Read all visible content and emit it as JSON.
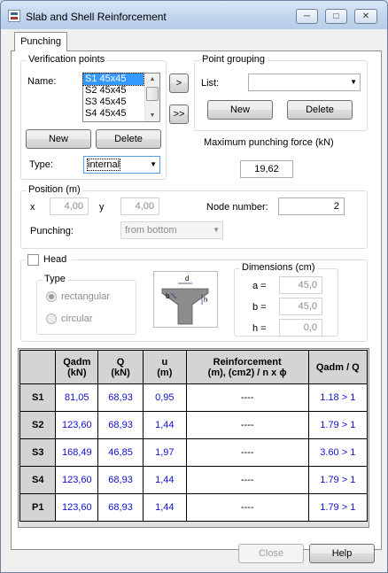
{
  "window": {
    "title": "Slab and Shell Reinforcement",
    "minimize": "─",
    "maximize": "□",
    "close": "✕"
  },
  "tabs": [
    {
      "label": "Punching"
    }
  ],
  "verification": {
    "legend": "Verification points",
    "name_label": "Name:",
    "items": [
      "S1 45x45",
      "S2 45x45",
      "S3 45x45",
      "S4 45x45"
    ],
    "selected_index": 0,
    "new_label": "New",
    "delete_label": "Delete",
    "type_label": "Type:",
    "type_value": "internal"
  },
  "transfer": {
    "move_one": ">",
    "move_all": ">>"
  },
  "grouping": {
    "legend": "Point grouping",
    "list_label": "List:",
    "list_value": "",
    "new_label": "New",
    "delete_label": "Delete"
  },
  "max_force": {
    "label": "Maximum punching force (kN)",
    "value": "19,62"
  },
  "position": {
    "legend": "Position (m)",
    "x_label": "x",
    "x_value": "4,00",
    "y_label": "y",
    "y_value": "4,00",
    "node_label": "Node number:",
    "node_value": "2",
    "punching_label": "Punching:",
    "punching_value": "from bottom"
  },
  "head": {
    "label": "Head",
    "checked": false,
    "type_legend": "Type",
    "options": [
      "rectangular",
      "circular"
    ],
    "selected": "rectangular",
    "diagram_labels": {
      "b": "b",
      "d": "d",
      "h": "h"
    }
  },
  "dimensions": {
    "legend": "Dimensions (cm)",
    "a_label": "a =",
    "a_value": "45,0",
    "b_label": "b =",
    "b_value": "45,0",
    "h_label": "h =",
    "h_value": "0,0"
  },
  "table": {
    "headers": [
      "",
      "Qadm\n(kN)",
      "Q\n(kN)",
      "u\n(m)",
      "Reinforcement\n(m), (cm2) / n x ϕ",
      "Qadm / Q"
    ],
    "rows": [
      {
        "id": "S1",
        "qadm": "81,05",
        "q": "68,93",
        "u": "0,95",
        "reinf": "----",
        "ratio": "1.18 > 1"
      },
      {
        "id": "S2",
        "qadm": "123,60",
        "q": "68,93",
        "u": "1,44",
        "reinf": "----",
        "ratio": "1.79 > 1"
      },
      {
        "id": "S3",
        "qadm": "168,49",
        "q": "46,85",
        "u": "1,97",
        "reinf": "----",
        "ratio": "3.60 > 1"
      },
      {
        "id": "S4",
        "qadm": "123,60",
        "q": "68,93",
        "u": "1,44",
        "reinf": "----",
        "ratio": "1.79 > 1"
      },
      {
        "id": "P1",
        "qadm": "123,60",
        "q": "68,93",
        "u": "1,44",
        "reinf": "----",
        "ratio": "1.79 > 1"
      }
    ]
  },
  "footer": {
    "close_label": "Close",
    "help_label": "Help"
  }
}
